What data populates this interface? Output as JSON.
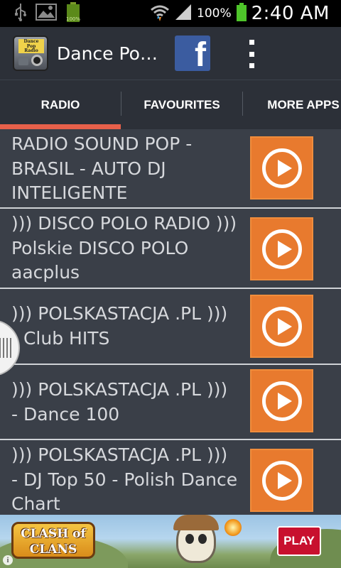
{
  "status_bar": {
    "battery_percent": "100%",
    "time": "2:40 AM",
    "icons": [
      "usb-icon",
      "image-icon",
      "battery-full-icon",
      "wifi-icon",
      "signal-icon",
      "battery-icon"
    ]
  },
  "action_bar": {
    "app_icon_text": [
      "Dance",
      "Pop",
      "Radio"
    ],
    "title": "Dance Po…",
    "facebook_label": "f"
  },
  "tabs": [
    {
      "label": "RADIO",
      "selected": true
    },
    {
      "label": "FAVOURITES",
      "selected": false
    },
    {
      "label": "MORE APPS",
      "selected": false
    }
  ],
  "stations": [
    {
      "name": "RADIO SOUND POP - BRASIL - AUTO DJ INTELIGENTE"
    },
    {
      "name": "))) DISCO POLO RADIO )))  Polskie DISCO POLO  aacplus"
    },
    {
      "name": "))) POLSKASTACJA .PL ))) - Club HITS"
    },
    {
      "name": "))) POLSKASTACJA .PL ))) - Dance 100"
    },
    {
      "name": "))) POLSKASTACJA .PL ))) - DJ Top 50 - Polish Dance Chart"
    }
  ],
  "ad": {
    "logo_text": "CLASH of CLANS",
    "cta": "PLAY",
    "info_mark": "i"
  },
  "colors": {
    "accent": "#e8604a",
    "play_button": "#e87a2e",
    "background": "#3a3f48",
    "bar": "#2c3038",
    "facebook": "#3b5ca0"
  }
}
